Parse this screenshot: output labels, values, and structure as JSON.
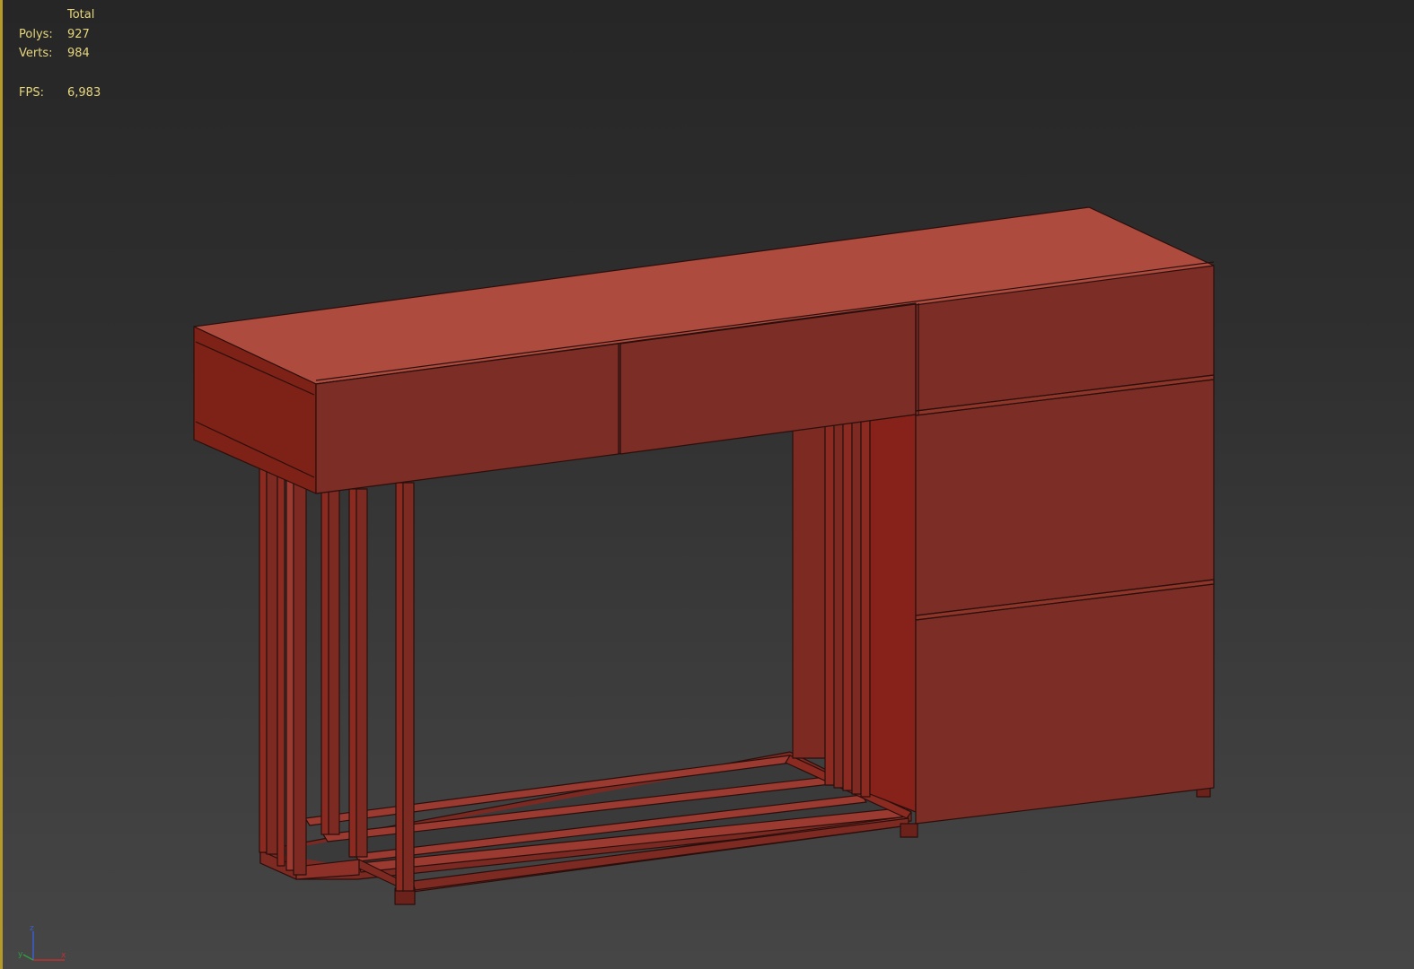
{
  "viewport": {
    "stats": {
      "header": "Total",
      "polys_label": "Polys:",
      "polys_value": "927",
      "verts_label": "Verts:",
      "verts_value": "984",
      "fps_label": "FPS:",
      "fps_value": "6,983"
    },
    "axis_gizmo": {
      "z_label": "z",
      "y_label": "y",
      "x_label": "x"
    }
  },
  "colors": {
    "accent_border": "#b59a2a",
    "stats_text": "#e6d67e",
    "model_top": "#ad4b3f",
    "model_front": "#7c2e26",
    "model_side": "#8a2219",
    "model_edge": "#2a0f0c"
  }
}
